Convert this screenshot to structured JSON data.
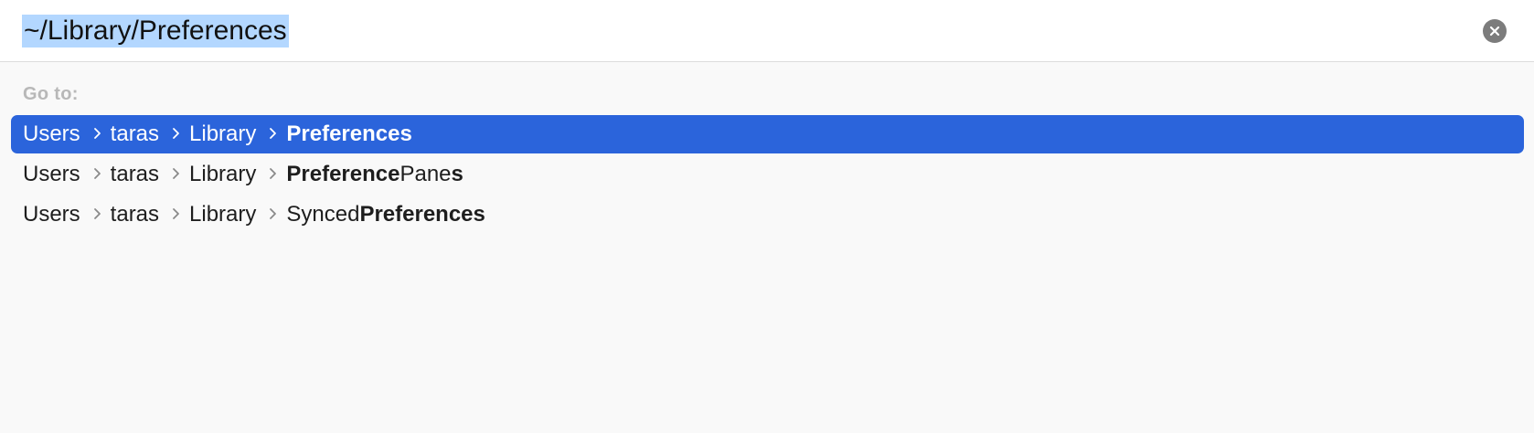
{
  "search": {
    "value": "~/Library/Preferences"
  },
  "goto_label": "Go to:",
  "separator_icon": "chevron-right-icon",
  "clear_icon": "close-icon",
  "colors": {
    "selected_row": "#2b64db",
    "text_selection": "#b3d7ff",
    "clear_button": "#7c7c7c"
  },
  "results": [
    {
      "selected": true,
      "crumbs": [
        "Users",
        "taras",
        "Library"
      ],
      "last_parts": [
        {
          "text": "Preferences",
          "bold": true
        }
      ]
    },
    {
      "selected": false,
      "crumbs": [
        "Users",
        "taras",
        "Library"
      ],
      "last_parts": [
        {
          "text": "Preference",
          "bold": true
        },
        {
          "text": "Pane",
          "bold": false
        },
        {
          "text": "s",
          "bold": true
        }
      ]
    },
    {
      "selected": false,
      "crumbs": [
        "Users",
        "taras",
        "Library"
      ],
      "last_parts": [
        {
          "text": "Synced",
          "bold": false
        },
        {
          "text": "Preferences",
          "bold": true
        }
      ]
    }
  ]
}
